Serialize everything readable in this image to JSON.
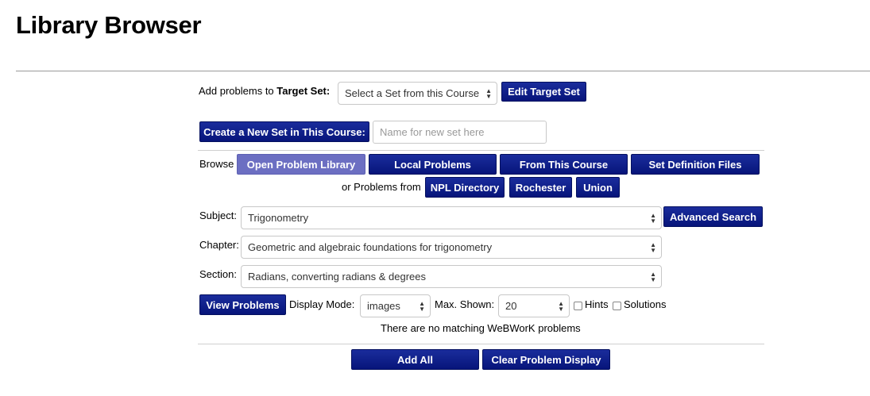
{
  "page": {
    "title": "Library Browser"
  },
  "target": {
    "label_prefix": "Add problems to ",
    "label_bold": "Target Set:",
    "select_value": "Select a Set from this Course",
    "edit_button": "Edit Target Set"
  },
  "newset": {
    "button": "Create a New Set in This Course:",
    "placeholder": "Name for new set here"
  },
  "browse": {
    "label": "Browse",
    "tabs": [
      {
        "label": "Open Problem Library",
        "active": true
      },
      {
        "label": "Local Problems",
        "active": false
      },
      {
        "label": "From This Course",
        "active": false
      },
      {
        "label": "Set Definition Files",
        "active": false
      }
    ],
    "or_label": "or Problems from",
    "sources": [
      "NPL Directory",
      "Rochester",
      "Union"
    ]
  },
  "filters": {
    "subject_label": "Subject:",
    "subject_value": "Trigonometry",
    "advanced_search": "Advanced Search",
    "chapter_label": "Chapter:",
    "chapter_value": "Geometric and algebraic foundations for trigonometry",
    "section_label": "Section:",
    "section_value": "Radians, converting radians & degrees"
  },
  "view": {
    "button": "View Problems",
    "display_mode_label": "Display Mode:",
    "display_mode_value": "images",
    "max_shown_label": "Max. Shown:",
    "max_shown_value": "20",
    "hints_label": "Hints",
    "solutions_label": "Solutions"
  },
  "status": "There are no matching WeBWorK problems",
  "footer": {
    "add_all": "Add All",
    "clear": "Clear Problem Display"
  },
  "colors": {
    "button": "#0c1b87",
    "active_tab": "#6c6fc2"
  }
}
